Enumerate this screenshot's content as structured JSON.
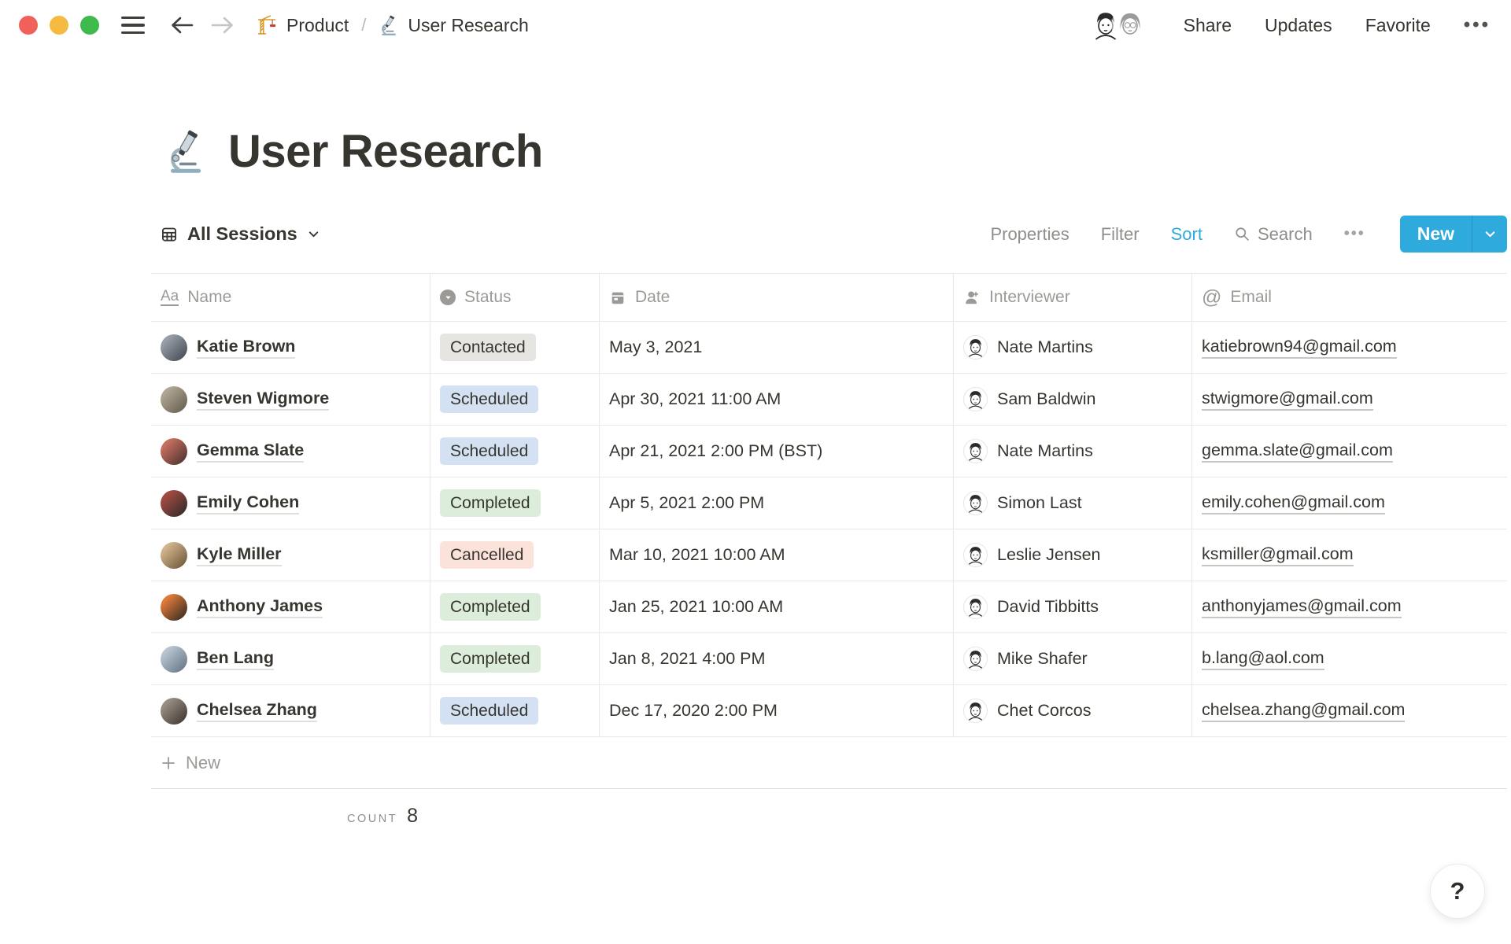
{
  "topbar": {
    "breadcrumb": {
      "product_icon": "crane-emoji",
      "product_label": "Product",
      "separator": "/",
      "page_icon": "microscope-emoji",
      "page_label": "User Research"
    },
    "avatars": [
      "member-avatar-1",
      "member-avatar-2"
    ],
    "share_label": "Share",
    "updates_label": "Updates",
    "favorite_label": "Favorite",
    "more_label": "•••"
  },
  "page": {
    "icon": "microscope-emoji",
    "title": "User Research"
  },
  "toolbar": {
    "view_icon": "table-view-icon",
    "view_name": "All Sessions",
    "properties_label": "Properties",
    "filter_label": "Filter",
    "sort_label": "Sort",
    "search_label": "Search",
    "more_label": "•••",
    "new_label": "New"
  },
  "table": {
    "columns": [
      {
        "key": "name",
        "label": "Name",
        "icon": "title-icon"
      },
      {
        "key": "status",
        "label": "Status",
        "icon": "select-icon"
      },
      {
        "key": "date",
        "label": "Date",
        "icon": "calendar-icon"
      },
      {
        "key": "interviewer",
        "label": "Interviewer",
        "icon": "person-icon"
      },
      {
        "key": "email",
        "label": "Email",
        "icon": "at-icon"
      }
    ],
    "rows": [
      {
        "name": "Katie Brown",
        "avatar_color": "#9aa0a8",
        "avatar_color2": "#4e5560",
        "status": "Contacted",
        "status_color": "gray",
        "date": "May 3, 2021",
        "interviewer": "Nate Martins",
        "email": "katiebrown94@gmail.com"
      },
      {
        "name": "Steven Wigmore",
        "avatar_color": "#b0a694",
        "avatar_color2": "#6e6657",
        "status": "Scheduled",
        "status_color": "blue",
        "date": "Apr 30, 2021 11:00 AM",
        "interviewer": "Sam Baldwin",
        "email": "stwigmore@gmail.com"
      },
      {
        "name": "Gemma Slate",
        "avatar_color": "#c96f5f",
        "avatar_color2": "#5a3a35",
        "status": "Scheduled",
        "status_color": "blue",
        "date": "Apr 21, 2021 2:00 PM (BST)",
        "interviewer": "Nate Martins",
        "email": "gemma.slate@gmail.com"
      },
      {
        "name": "Emily Cohen",
        "avatar_color": "#a34a42",
        "avatar_color2": "#3f2e2c",
        "status": "Completed",
        "status_color": "green",
        "date": "Apr 5, 2021 2:00 PM",
        "interviewer": "Simon Last",
        "email": "emily.cohen@gmail.com"
      },
      {
        "name": "Kyle Miller",
        "avatar_color": "#d2b48c",
        "avatar_color2": "#7a6243",
        "status": "Cancelled",
        "status_color": "red",
        "date": "Mar 10, 2021 10:00 AM",
        "interviewer": "Leslie Jensen",
        "email": "ksmiller@gmail.com"
      },
      {
        "name": "Anthony James",
        "avatar_color": "#e07b39",
        "avatar_color2": "#4a3425",
        "status": "Completed",
        "status_color": "green",
        "date": "Jan 25, 2021 10:00 AM",
        "interviewer": "David Tibbitts",
        "email": "anthonyjames@gmail.com"
      },
      {
        "name": "Ben Lang",
        "avatar_color": "#b8c4d0",
        "avatar_color2": "#708090",
        "status": "Completed",
        "status_color": "green",
        "date": "Jan 8, 2021 4:00 PM",
        "interviewer": "Mike Shafer",
        "email": "b.lang@aol.com"
      },
      {
        "name": "Chelsea Zhang",
        "avatar_color": "#9a8f85",
        "avatar_color2": "#4a4038",
        "status": "Scheduled",
        "status_color": "blue",
        "date": "Dec 17, 2020 2:00 PM",
        "interviewer": "Chet Corcos",
        "email": "chelsea.zhang@gmail.com"
      }
    ],
    "new_row_label": "New",
    "count_label": "COUNT",
    "count_value": "8"
  },
  "help": {
    "label": "?"
  },
  "colors": {
    "accent_blue": "#2EAADC",
    "text_dark": "#37352F",
    "text_gray": "#9B9A97",
    "divider": "#E9E9E7",
    "badge_gray": "#E6E5E2",
    "badge_blue": "#D3E1F3",
    "badge_green": "#DCEDDC",
    "badge_red": "#FBE2DA",
    "traffic_red": "#F1605A",
    "traffic_yellow": "#F5BB41",
    "traffic_green": "#3FBB4E"
  }
}
